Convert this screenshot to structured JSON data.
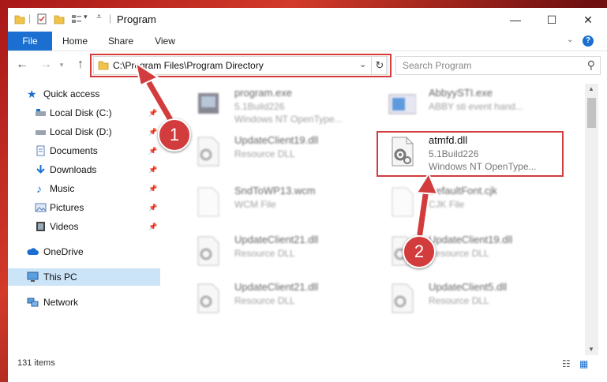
{
  "window": {
    "title": "Program",
    "controls": {
      "minimize": "—",
      "maximize": "☐",
      "close": "✕"
    }
  },
  "ribbon": {
    "tabs": [
      "File",
      "Home",
      "Share",
      "View"
    ],
    "help": "?"
  },
  "address_bar": {
    "path": "C:\\Program Files\\Program Directory",
    "search_placeholder": "Search Program"
  },
  "sidebar": {
    "items": [
      {
        "label": "Quick access",
        "icon": "star-icon"
      },
      {
        "label": "Local Disk (C:)",
        "icon": "drive-icon"
      },
      {
        "label": "Local Disk (D:)",
        "icon": "drive-icon"
      },
      {
        "label": "Documents",
        "icon": "documents-icon"
      },
      {
        "label": "Downloads",
        "icon": "download-icon"
      },
      {
        "label": "Music",
        "icon": "music-icon"
      },
      {
        "label": "Pictures",
        "icon": "pictures-icon"
      },
      {
        "label": "Videos",
        "icon": "videos-icon"
      },
      {
        "label": "OneDrive",
        "icon": "cloud-icon"
      },
      {
        "label": "This PC",
        "icon": "computer-icon"
      },
      {
        "label": "Network",
        "icon": "network-icon"
      }
    ]
  },
  "files": [
    {
      "name": "program.exe",
      "line1": "5.1Build226",
      "line2": "Windows NT OpenType..."
    },
    {
      "name": "AbbyySTI.exe",
      "line1": "ABBY sti event hand...",
      "line2": ""
    },
    {
      "name": "UpdateClient19.dll",
      "line1": "Resource DLL",
      "line2": ""
    },
    {
      "name": "atmfd.dll",
      "line1": "5.1Build226",
      "line2": "Windows NT OpenType..."
    },
    {
      "name": "SndToWP13.wcm",
      "line1": "WCM File",
      "line2": ""
    },
    {
      "name": "DefaultFont.cjk",
      "line1": "CJK File",
      "line2": ""
    },
    {
      "name": "UpdateClient21.dll",
      "line1": "Resource DLL",
      "line2": ""
    },
    {
      "name": "UpdateClient19.dll",
      "line1": "Resource DLL",
      "line2": ""
    },
    {
      "name": "UpdateClient21.dll",
      "line1": "Resource DLL",
      "line2": ""
    },
    {
      "name": "UpdateClient5.dll",
      "line1": "Resource DLL",
      "line2": ""
    }
  ],
  "status": {
    "items": "131 items"
  },
  "annotations": {
    "step1": "1",
    "step2": "2"
  },
  "colors": {
    "accent": "#1a6fd0",
    "highlight": "#d23c3c",
    "selected": "#cce4f7"
  }
}
